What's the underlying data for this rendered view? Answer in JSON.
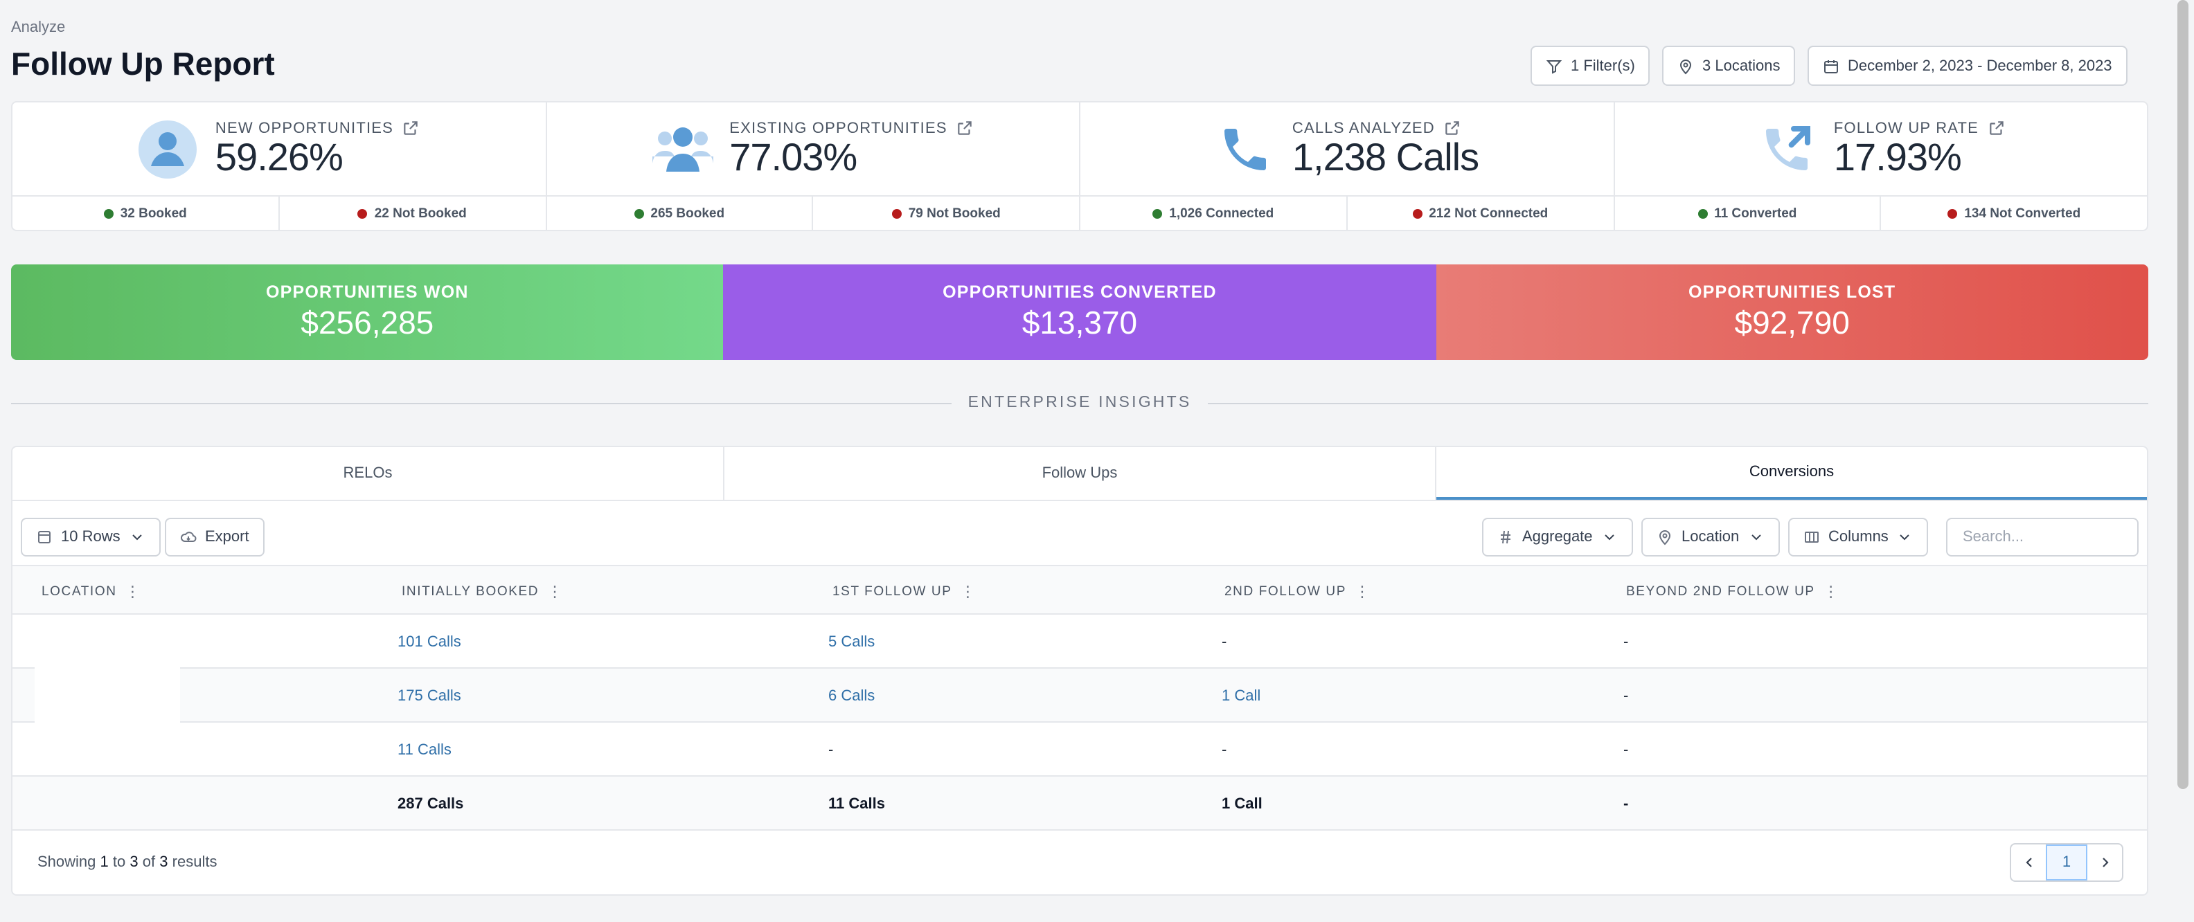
{
  "header": {
    "breadcrumb": "Analyze",
    "title": "Follow Up Report",
    "filters_label": "1 Filter(s)",
    "locations_label": "3 Locations",
    "date_range": "December 2, 2023 - December 8, 2023"
  },
  "stats": [
    {
      "label": "NEW OPPORTUNITIES",
      "value": "59.26%",
      "icon": "user-icon",
      "left": {
        "text": "32 Booked",
        "color": "#2e7d32"
      },
      "right": {
        "text": "22 Not Booked",
        "color": "#b71c1c"
      }
    },
    {
      "label": "EXISTING OPPORTUNITIES",
      "value": "77.03%",
      "icon": "users-icon",
      "left": {
        "text": "265 Booked",
        "color": "#2e7d32"
      },
      "right": {
        "text": "79 Not Booked",
        "color": "#b71c1c"
      }
    },
    {
      "label": "CALLS ANALYZED",
      "value": "1,238 Calls",
      "icon": "phone-icon",
      "left": {
        "text": "1,026 Connected",
        "color": "#2e7d32"
      },
      "right": {
        "text": "212 Not Connected",
        "color": "#b71c1c"
      }
    },
    {
      "label": "FOLLOW UP RATE",
      "value": "17.93%",
      "icon": "phone-outgoing-icon",
      "left": {
        "text": "11 Converted",
        "color": "#2e7d32"
      },
      "right": {
        "text": "134 Not Converted",
        "color": "#b71c1c"
      }
    }
  ],
  "banners": [
    {
      "label": "OPPORTUNITIES WON",
      "value": "$256,285"
    },
    {
      "label": "OPPORTUNITIES CONVERTED",
      "value": "$13,370"
    },
    {
      "label": "OPPORTUNITIES LOST",
      "value": "$92,790"
    }
  ],
  "colors": {
    "won_start": "#5cba61",
    "won_end": "#74d98a",
    "converted": "#9a5de8",
    "lost_start": "#e87c76",
    "lost_end": "#e0514a",
    "link": "#2f6fa8",
    "tab_accent": "#4a90c9"
  },
  "section_title": "ENTERPRISE INSIGHTS",
  "tabs": [
    "RELOs",
    "Follow Ups",
    "Conversions"
  ],
  "active_tab": "Conversions",
  "toolbar": {
    "rows_label": "10 Rows",
    "export_label": "Export",
    "aggregate_label": "Aggregate",
    "location_label": "Location",
    "columns_label": "Columns",
    "search_placeholder": "Search..."
  },
  "table": {
    "columns": [
      "LOCATION",
      "INITIALLY BOOKED",
      "1ST FOLLOW UP",
      "2ND FOLLOW UP",
      "BEYOND 2ND FOLLOW UP"
    ],
    "rows": [
      [
        "",
        "101 Calls",
        "5 Calls",
        "-",
        "-"
      ],
      [
        "",
        "175 Calls",
        "6 Calls",
        "1 Call",
        "-"
      ],
      [
        "",
        "11 Calls",
        "-",
        "-",
        "-"
      ]
    ],
    "totals": [
      "",
      "287 Calls",
      "11 Calls",
      "1 Call",
      "-"
    ]
  },
  "footer": {
    "showing_prefix": "Showing",
    "from": "1",
    "to_word": "to",
    "to": "3",
    "of_word": "of",
    "total": "3",
    "results_word": "results",
    "current_page": "1"
  }
}
